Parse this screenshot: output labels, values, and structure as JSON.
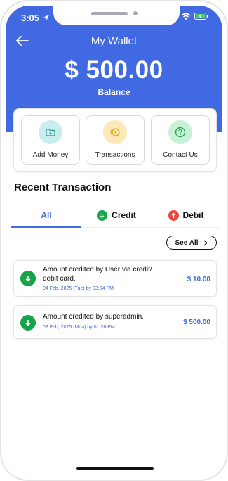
{
  "status_bar": {
    "time": "3:05"
  },
  "header": {
    "title": "My Wallet",
    "amount": "$ 500.00",
    "balance_label": "Balance"
  },
  "quick_actions": [
    {
      "label": "Add Money",
      "icon": "folder-icon",
      "bg": "#c9ecec",
      "fg": "#2a9d9d"
    },
    {
      "label": "Transactions",
      "icon": "coins-icon",
      "bg": "#fde9b7",
      "fg": "#e0a800"
    },
    {
      "label": "Contact Us",
      "icon": "help-icon",
      "bg": "#c8f1d6",
      "fg": "#1f9d55"
    }
  ],
  "section": {
    "title": "Recent Transaction"
  },
  "tabs": [
    {
      "label": "All",
      "active": true
    },
    {
      "label": "Credit",
      "icon": "arrow-down-circle-icon",
      "color": "#16a34a"
    },
    {
      "label": "Debit",
      "icon": "arrow-up-circle-icon",
      "color": "#ef4444"
    }
  ],
  "see_all": {
    "label": "See All"
  },
  "transactions": [
    {
      "description": "Amount credited by User via credit/ debit card.",
      "date": "04 Feb, 2025 (Tue) by 03:04 PM",
      "amount": "$ 10.00",
      "type": "credit"
    },
    {
      "description": "Amount credited by superadmin.",
      "date": "03 Feb, 2025 (Mon) by 01:26 PM",
      "amount": "$ 500.00",
      "type": "credit"
    }
  ],
  "colors": {
    "primary": "#4169e1",
    "credit": "#16a34a",
    "debit": "#ef4444"
  }
}
